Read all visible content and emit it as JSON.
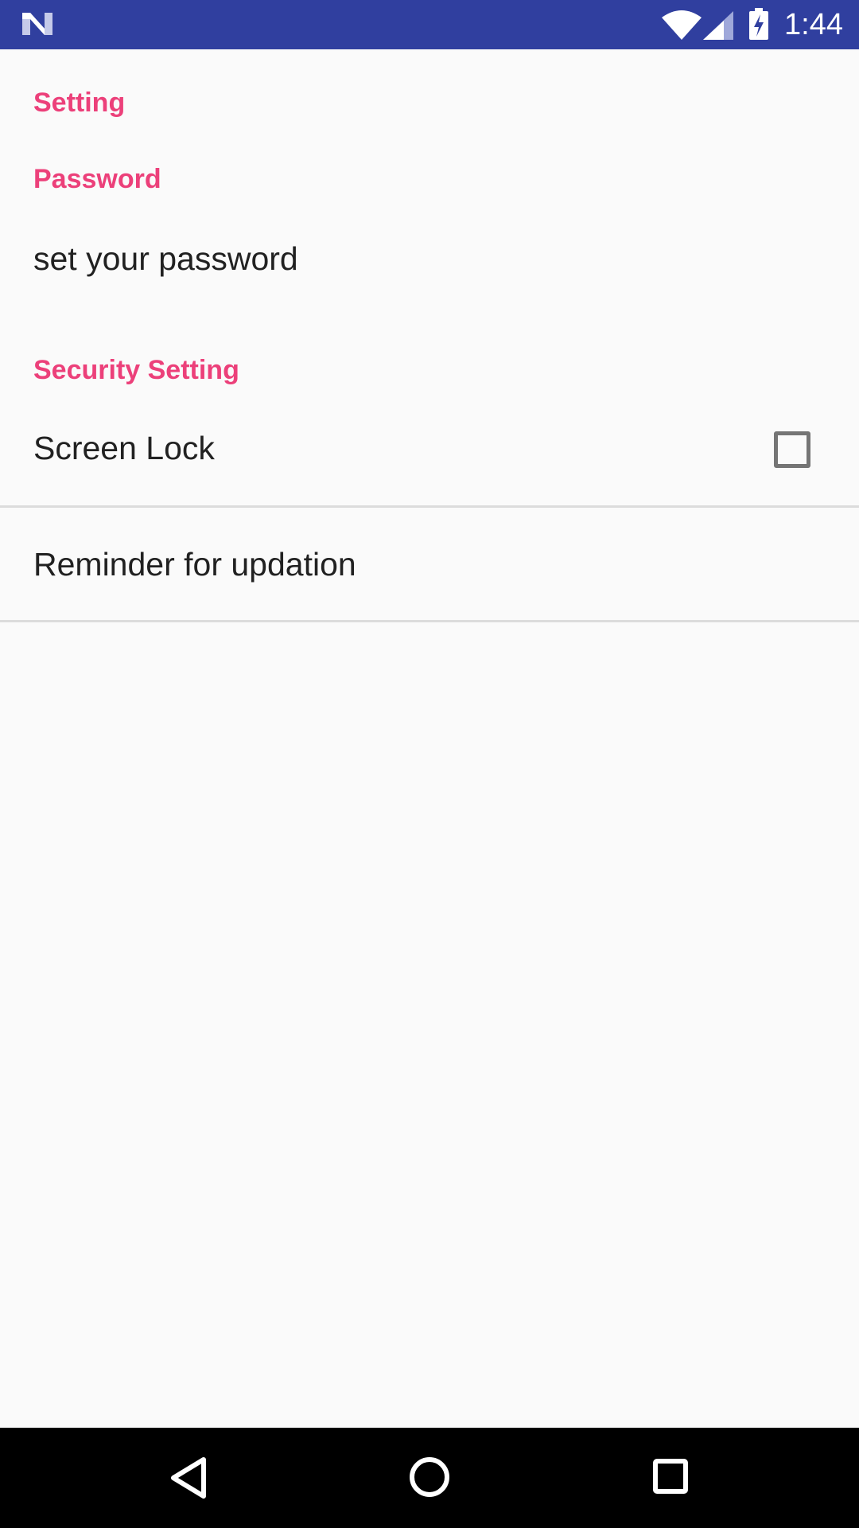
{
  "status_bar": {
    "time": "1:44",
    "icons": [
      "n-logo-icon",
      "wifi-icon",
      "cell-signal-icon",
      "battery-charging-icon"
    ],
    "background": "#303f9f"
  },
  "settings": {
    "header": "Setting",
    "password_category": "Password",
    "password_item": "set your password",
    "security_category": "Security Setting",
    "screen_lock_label": "Screen Lock",
    "screen_lock_checked": false,
    "reminder_label": "Reminder for updation",
    "accent_color": "#ec407a"
  },
  "nav_bar": {
    "icons": [
      "back-icon",
      "home-icon",
      "recents-icon"
    ]
  }
}
